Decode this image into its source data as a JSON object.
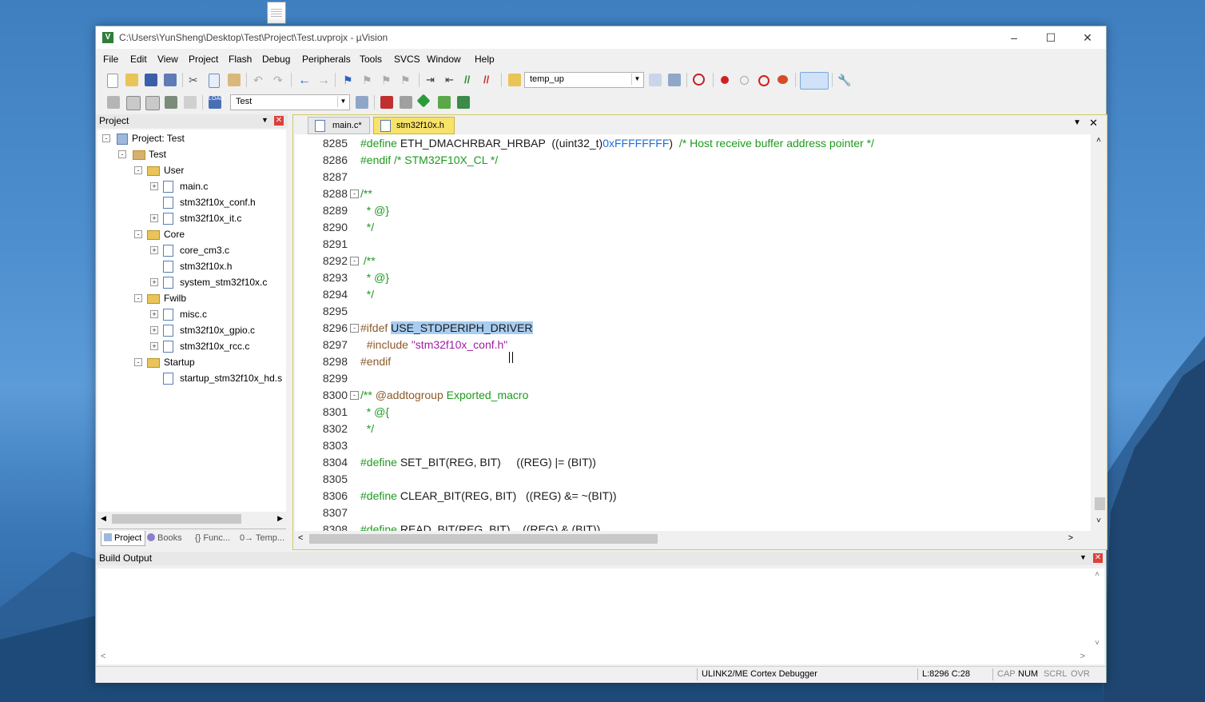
{
  "window": {
    "title": "C:\\Users\\YunSheng\\Desktop\\Test\\Project\\Test.uvprojx - µVision",
    "app_icon_letter": "V"
  },
  "menu": [
    "File",
    "Edit",
    "View",
    "Project",
    "Flash",
    "Debug",
    "Peripherals",
    "Tools",
    "SVCS",
    "Window",
    "Help"
  ],
  "toolbar": {
    "find_combo_value": "temp_up",
    "target_combo_value": "Test"
  },
  "project_panel": {
    "title": "Project",
    "tree": [
      {
        "label": "Project: Test",
        "depth": 0,
        "type": "project",
        "expander": "-"
      },
      {
        "label": "Test",
        "depth": 1,
        "type": "target",
        "expander": "-"
      },
      {
        "label": "User",
        "depth": 2,
        "type": "folder",
        "expander": "-"
      },
      {
        "label": "main.c",
        "depth": 3,
        "type": "file",
        "expander": "+"
      },
      {
        "label": "stm32f10x_conf.h",
        "depth": 3,
        "type": "file",
        "expander": ""
      },
      {
        "label": "stm32f10x_it.c",
        "depth": 3,
        "type": "file",
        "expander": "+"
      },
      {
        "label": "Core",
        "depth": 2,
        "type": "folder",
        "expander": "-"
      },
      {
        "label": "core_cm3.c",
        "depth": 3,
        "type": "file",
        "expander": "+"
      },
      {
        "label": "stm32f10x.h",
        "depth": 3,
        "type": "file",
        "expander": ""
      },
      {
        "label": "system_stm32f10x.c",
        "depth": 3,
        "type": "file",
        "expander": "+"
      },
      {
        "label": "Fwilb",
        "depth": 2,
        "type": "folder",
        "expander": "-"
      },
      {
        "label": "misc.c",
        "depth": 3,
        "type": "file",
        "expander": "+"
      },
      {
        "label": "stm32f10x_gpio.c",
        "depth": 3,
        "type": "file",
        "expander": "+"
      },
      {
        "label": "stm32f10x_rcc.c",
        "depth": 3,
        "type": "file",
        "expander": "+"
      },
      {
        "label": "Startup",
        "depth": 2,
        "type": "folder",
        "expander": "-"
      },
      {
        "label": "startup_stm32f10x_hd.s",
        "depth": 3,
        "type": "file",
        "expander": ""
      }
    ],
    "bottom_tabs": [
      "Project",
      "Books",
      "{} Func...",
      "0→ Temp..."
    ]
  },
  "editor": {
    "tabs": [
      {
        "label": "main.c*",
        "active": false
      },
      {
        "label": "stm32f10x.h",
        "active": true
      }
    ],
    "lines": [
      {
        "n": "8285",
        "fold": "",
        "parts": [
          [
            "c-green",
            "#define "
          ],
          [
            "c-black",
            "ETH_DMACHRBAR_HRBAP  ((uint32_t)"
          ],
          [
            "c-blue",
            "0xFFFFFFFF"
          ],
          [
            "c-black",
            ")  "
          ],
          [
            "c-green",
            "/* Host receive buffer address pointer */"
          ]
        ]
      },
      {
        "n": "8286",
        "fold": "",
        "parts": [
          [
            "c-green",
            "#endif /* STM32F10X_CL */"
          ]
        ]
      },
      {
        "n": "8287",
        "fold": "",
        "parts": []
      },
      {
        "n": "8288",
        "fold": "-",
        "parts": [
          [
            "c-green",
            "/**"
          ]
        ]
      },
      {
        "n": "8289",
        "fold": "",
        "parts": [
          [
            "c-green",
            "  * @}"
          ]
        ]
      },
      {
        "n": "8290",
        "fold": "",
        "parts": [
          [
            "c-green",
            "  */"
          ]
        ]
      },
      {
        "n": "8291",
        "fold": "",
        "parts": []
      },
      {
        "n": "8292",
        "fold": "-",
        "parts": [
          [
            "c-green",
            " /**"
          ]
        ]
      },
      {
        "n": "8293",
        "fold": "",
        "parts": [
          [
            "c-green",
            "  * @}"
          ]
        ]
      },
      {
        "n": "8294",
        "fold": "",
        "parts": [
          [
            "c-green",
            "  */"
          ]
        ]
      },
      {
        "n": "8295",
        "fold": "",
        "parts": []
      },
      {
        "n": "8296",
        "fold": "-",
        "parts": [
          [
            "c-brown",
            "#ifdef "
          ],
          [
            "c-black sel",
            "USE_STDPERIPH_DRIVER"
          ]
        ]
      },
      {
        "n": "8297",
        "fold": "",
        "parts": [
          [
            "c-brown",
            "  #include "
          ],
          [
            "c-purple",
            "\"stm32f10x_conf.h\""
          ]
        ]
      },
      {
        "n": "8298",
        "fold": "",
        "parts": [
          [
            "c-brown",
            "#endif"
          ]
        ]
      },
      {
        "n": "8299",
        "fold": "",
        "parts": []
      },
      {
        "n": "8300",
        "fold": "-",
        "parts": [
          [
            "c-green",
            "/** "
          ],
          [
            "c-brown",
            "@addtogroup"
          ],
          [
            "c-green",
            " Exported_macro"
          ]
        ]
      },
      {
        "n": "8301",
        "fold": "",
        "parts": [
          [
            "c-green",
            "  * @{"
          ]
        ]
      },
      {
        "n": "8302",
        "fold": "",
        "parts": [
          [
            "c-green",
            "  */"
          ]
        ]
      },
      {
        "n": "8303",
        "fold": "",
        "parts": []
      },
      {
        "n": "8304",
        "fold": "",
        "parts": [
          [
            "c-green",
            "#define "
          ],
          [
            "c-black",
            "SET_BIT(REG, BIT)     ((REG) |= (BIT))"
          ]
        ]
      },
      {
        "n": "8305",
        "fold": "",
        "parts": []
      },
      {
        "n": "8306",
        "fold": "",
        "parts": [
          [
            "c-green",
            "#define "
          ],
          [
            "c-black",
            "CLEAR_BIT(REG, BIT)   ((REG) &= ~(BIT))"
          ]
        ]
      },
      {
        "n": "8307",
        "fold": "",
        "parts": []
      },
      {
        "n": "8308",
        "fold": "",
        "parts": [
          [
            "c-green",
            "#define "
          ],
          [
            "c-black",
            "READ_BIT(REG, BIT)    ((REG) & (BIT))"
          ]
        ]
      }
    ]
  },
  "build_output": {
    "title": "Build Output"
  },
  "status_bar": {
    "debugger": "ULINK2/ME Cortex Debugger",
    "position": "L:8296 C:28",
    "cap": "CAP",
    "num": "NUM",
    "scrl": "SCRL",
    "ovr": "OVR"
  }
}
